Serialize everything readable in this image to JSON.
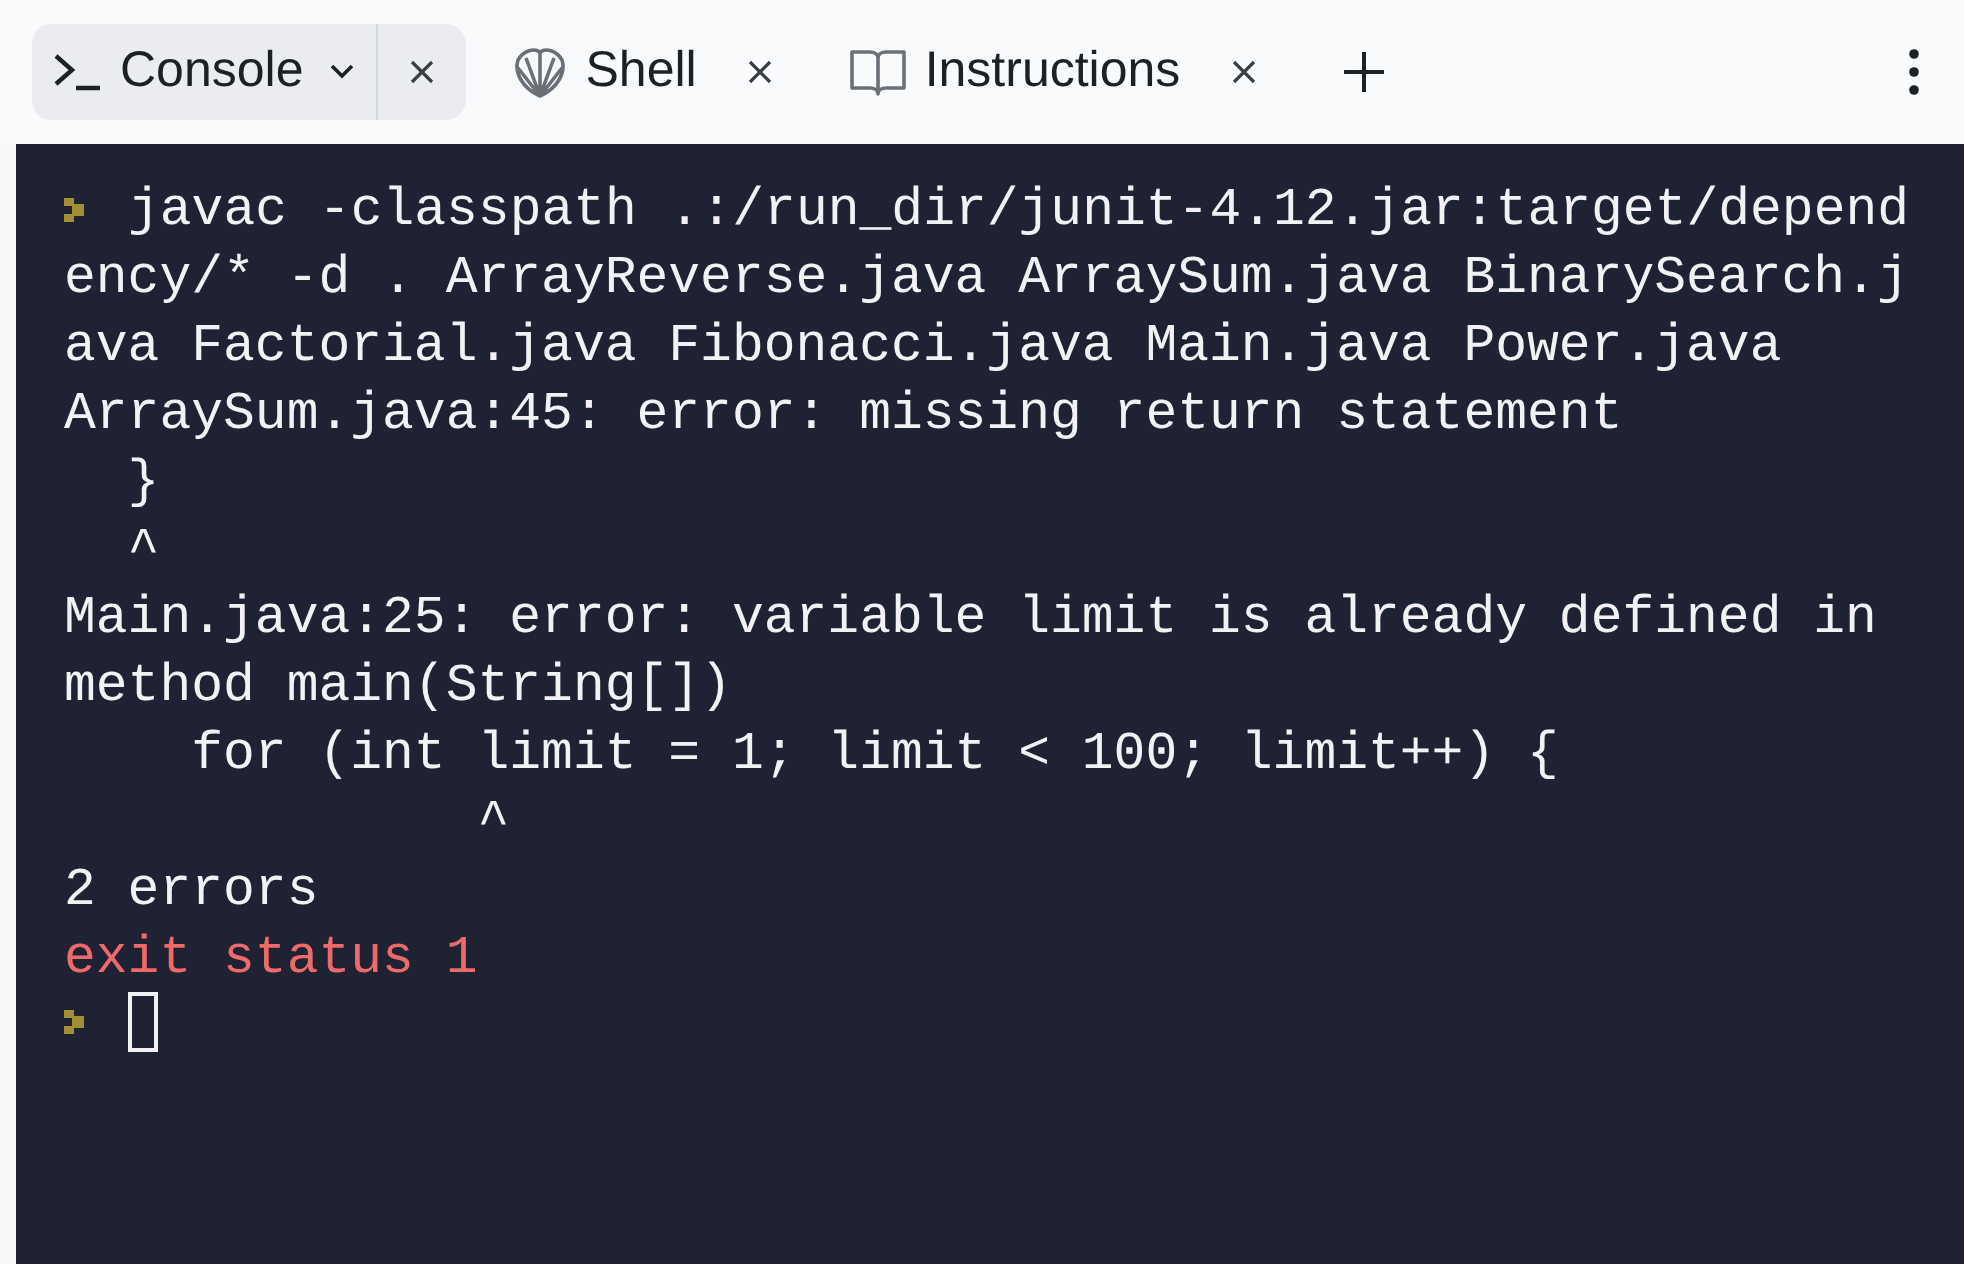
{
  "tabs": [
    {
      "label": "Console",
      "kind": "console",
      "selected": true,
      "has_menu": true
    },
    {
      "label": "Shell",
      "kind": "shell",
      "selected": false,
      "has_menu": false
    },
    {
      "label": "Instructions",
      "kind": "instructions",
      "selected": false,
      "has_menu": false
    }
  ],
  "console": {
    "lines": [
      {
        "kind": "command",
        "text": "javac -classpath .:/run_dir/junit-4.12.jar:target/depend"
      },
      {
        "kind": "output",
        "text": "ency/* -d . ArrayReverse.java ArraySum.java BinarySearch.j"
      },
      {
        "kind": "output",
        "text": "ava Factorial.java Fibonacci.java Main.java Power.java"
      },
      {
        "kind": "output",
        "text": "ArraySum.java:45: error: missing return statement"
      },
      {
        "kind": "output",
        "text": "  }"
      },
      {
        "kind": "output",
        "text": "  ^"
      },
      {
        "kind": "output",
        "text": "Main.java:25: error: variable limit is already defined in"
      },
      {
        "kind": "output",
        "text": "method main(String[])"
      },
      {
        "kind": "output",
        "text": "    for (int limit = 1; limit < 100; limit++) {"
      },
      {
        "kind": "output",
        "text": "             ^"
      },
      {
        "kind": "output",
        "text": "2 errors"
      },
      {
        "kind": "error",
        "text": "exit status 1"
      },
      {
        "kind": "input"
      }
    ]
  }
}
